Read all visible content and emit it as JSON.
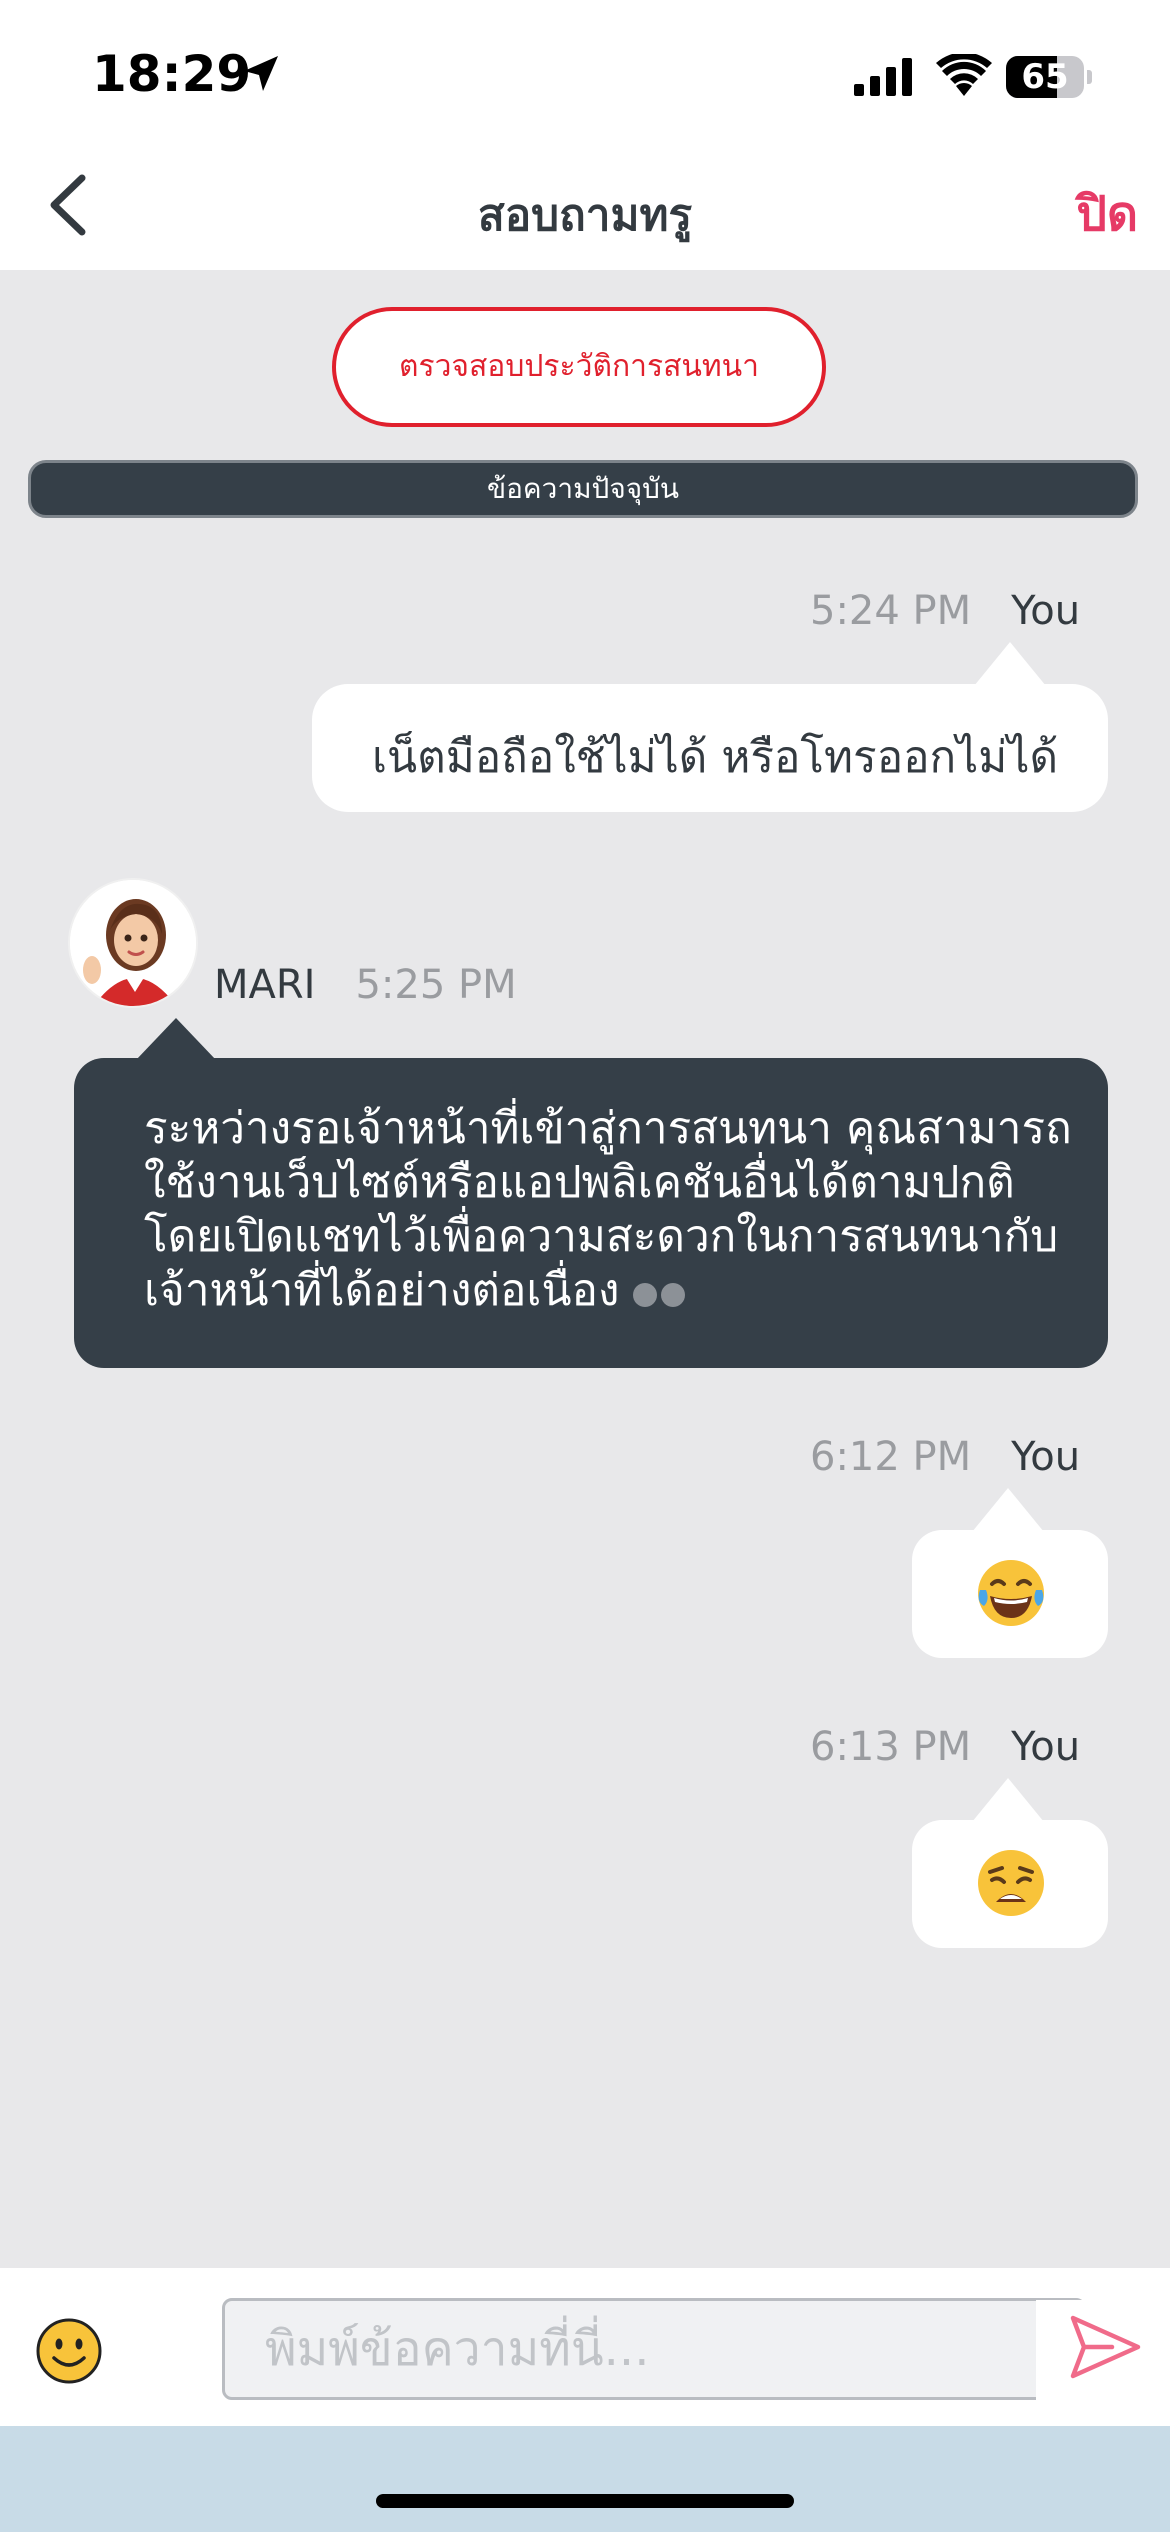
{
  "status_bar": {
    "time": "18:29",
    "battery": "65",
    "battery_level": 0.65
  },
  "header": {
    "title": "สอบถามทรู",
    "close_label": "ปิด"
  },
  "chat": {
    "history_button": "ตรวจสอบประวัติการสนทนา",
    "divider_label": "ข้อความปัจจุบัน",
    "messages": [
      {
        "sender": "You",
        "time": "5:24 PM",
        "text": "เน็ตมือถือใช้ไม่ได้ หรือโทรออกไม่ได้"
      },
      {
        "sender": "MARI",
        "time": "5:25 PM",
        "lines": [
          "ระหว่างรอเจ้าหน้าที่เข้าสู่การสนทนา คุณสามารถ",
          "ใช้งานเว็บไซต์หรือแอปพลิเคชันอื่นได้ตามปกติ",
          "โดยเปิดแชทไว้เพื่อความสะดวกในการสนทนากับ",
          "เจ้าหน้าที่ได้อย่างต่อเนื่อง"
        ]
      },
      {
        "sender": "You",
        "time": "6:12 PM",
        "emoji": "face-with-tears-of-joy"
      },
      {
        "sender": "You",
        "time": "6:13 PM",
        "emoji": "weary-face"
      }
    ]
  },
  "input": {
    "placeholder": "พิมพ์ข้อความที่นี่..."
  },
  "colors": {
    "accent": "#e63a66",
    "history_red": "#e0202d",
    "dark_bubble": "#353f48",
    "chat_bg": "#e8e8ea"
  }
}
